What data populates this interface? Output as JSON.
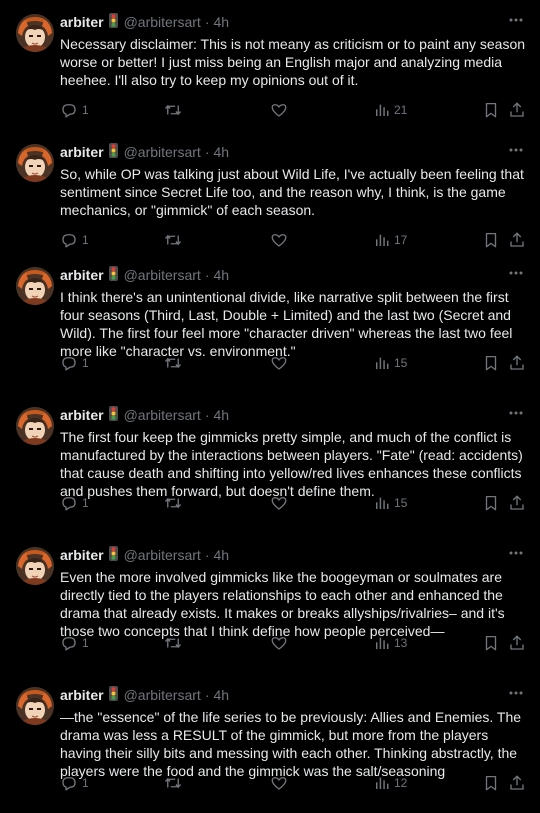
{
  "tweets": [
    {
      "name": "arbiter",
      "handle": "@arbitersart",
      "separator": "·",
      "time": "4h",
      "text": "Necessary disclaimer: This is not meany as criticism or to paint any season worse or better! I just miss being an English major and analyzing media heehee. I'll also try to keep my opinions out of it.",
      "replies": "1",
      "views": "21"
    },
    {
      "name": "arbiter",
      "handle": "@arbitersart",
      "separator": "·",
      "time": "4h",
      "text": "So, while OP was talking just about Wild Life, I've actually been feeling that sentiment since Secret Life too, and the reason why, I think, is the game mechanics, or \"gimmick\" of each season.",
      "replies": "1",
      "views": "17"
    },
    {
      "name": "arbiter",
      "handle": "@arbitersart",
      "separator": "·",
      "time": "4h",
      "text": "I think there's an unintentional divide, like narrative split between the first four seasons (Third, Last, Double + Limited) and the last two (Secret and Wild). The first four feel more \"character driven\" whereas the last two feel more like \"character vs. environment.\"",
      "replies": "1",
      "views": "15"
    },
    {
      "name": "arbiter",
      "handle": "@arbitersart",
      "separator": "·",
      "time": "4h",
      "text": "The first four keep the gimmicks pretty simple, and much of the conflict is manufactured by the interactions between players. \"Fate\" (read: accidents) that cause death and shifting into yellow/red lives enhances these conflicts and pushes them forward, but doesn't define them.",
      "replies": "1",
      "views": "15"
    },
    {
      "name": "arbiter",
      "handle": "@arbitersart",
      "separator": "·",
      "time": "4h",
      "text": "Even the more involved gimmicks like the boogeyman or soulmates are directly tied to the players relationships to each other and enhanced the drama that already exists. It makes or breaks allyships/rivalries– and it's those two concepts that I think define how people perceived—",
      "replies": "1",
      "views": "13"
    },
    {
      "name": "arbiter",
      "handle": "@arbitersart",
      "separator": "·",
      "time": "4h",
      "text": "—the \"essence\" of the life series to be previously: Allies and Enemies. The drama was less a RESULT of the gimmick, but more from the players having their silly bits and messing with each other. Thinking abstractly, the players were the food and the gimmick was the salt/seasoning",
      "replies": "1",
      "views": "12"
    }
  ],
  "icons": {
    "status_emoji": "traffic-light-icon",
    "more": "more-icon",
    "reply": "reply-icon",
    "retweet": "retweet-icon",
    "like": "heart-icon",
    "views": "views-icon",
    "bookmark": "bookmark-icon",
    "share": "share-icon"
  },
  "colors": {
    "background": "#000000",
    "text": "#e7e9ea",
    "muted": "#71767b"
  }
}
